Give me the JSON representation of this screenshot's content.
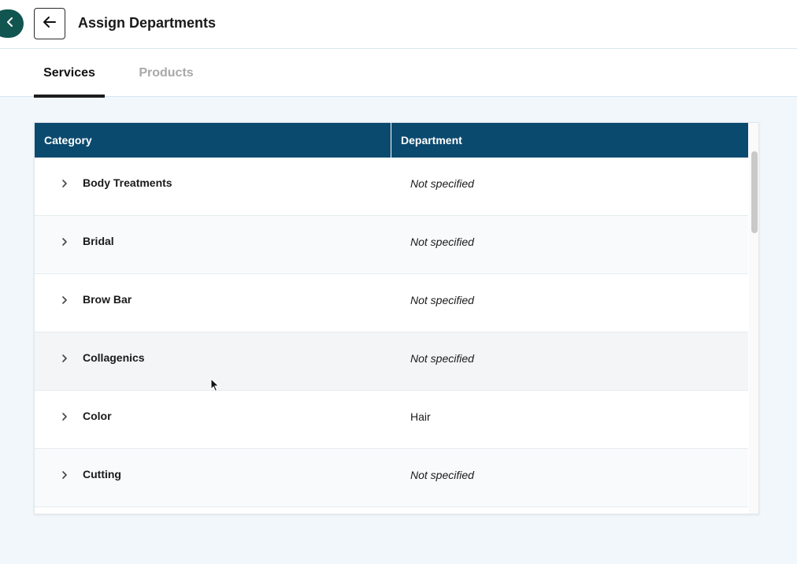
{
  "header": {
    "title": "Assign Departments",
    "back_icon": "arrow-left-icon",
    "side_toggle_icon": "chevron-left-icon",
    "side_toggle_color": "#10554f"
  },
  "tabs": [
    {
      "label": "Services",
      "active": true
    },
    {
      "label": "Products",
      "active": false
    }
  ],
  "table": {
    "header_color": "#0b4a6f",
    "columns": [
      "Category",
      "Department"
    ],
    "rows": [
      {
        "category": "Body Treatments",
        "department": "Not specified"
      },
      {
        "category": "Bridal",
        "department": "Not specified"
      },
      {
        "category": "Brow Bar",
        "department": "Not specified"
      },
      {
        "category": "Collagenics",
        "department": "Not specified"
      },
      {
        "category": "Color",
        "department": "Hair"
      },
      {
        "category": "Cutting",
        "department": "Not specified"
      }
    ]
  }
}
